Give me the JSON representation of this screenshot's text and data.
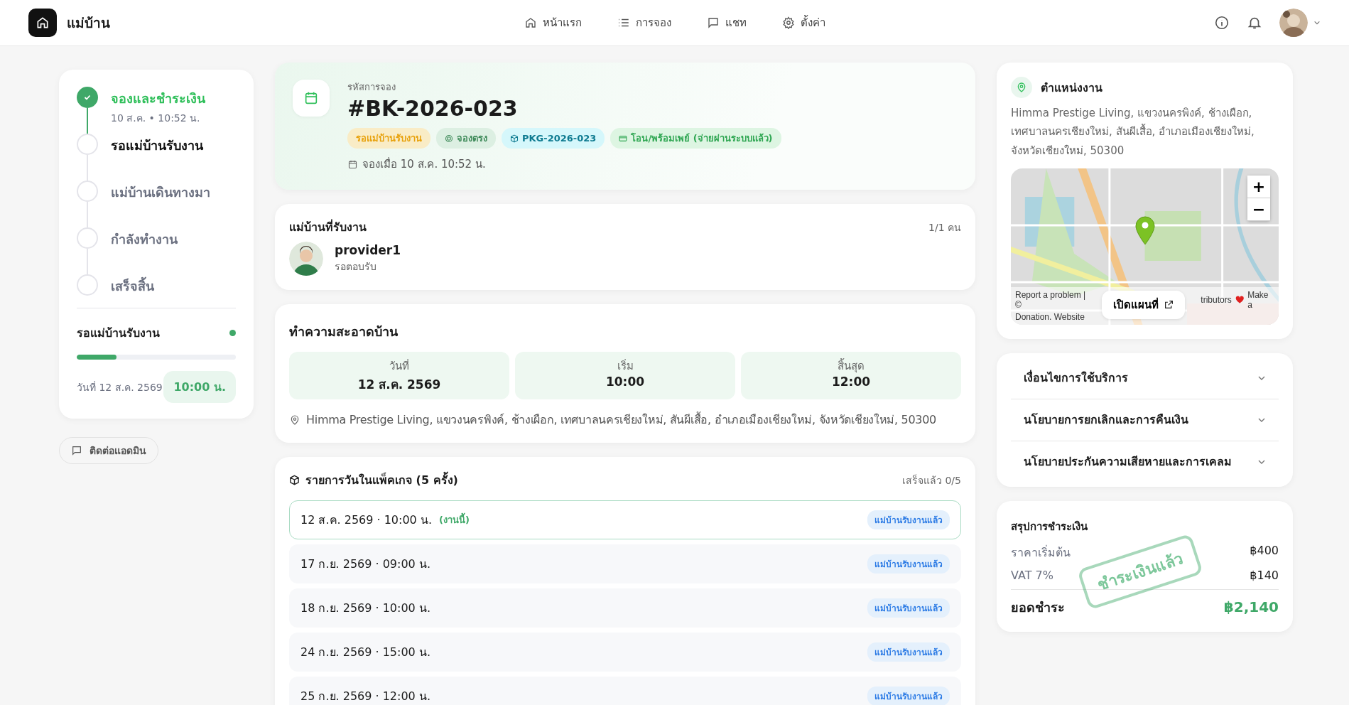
{
  "header": {
    "brand": "แม่บ้าน",
    "nav": [
      {
        "label": "หน้าแรก"
      },
      {
        "label": "การจอง"
      },
      {
        "label": "แชท"
      },
      {
        "label": "ตั้งค่า"
      }
    ]
  },
  "progress": {
    "steps": [
      {
        "label": "จองและชำระเงิน",
        "time": "10 ส.ค. • 10:52 น.",
        "kind": "done"
      },
      {
        "label": "รอแม่บ้านรับงาน",
        "kind": "current"
      },
      {
        "label": "แม่บ้านเดินทางมา",
        "kind": "pending"
      },
      {
        "label": "กำลังทำงาน",
        "kind": "pending"
      },
      {
        "label": "เสร็จสิ้น",
        "kind": "pending"
      }
    ],
    "status": "รอแม่บ้านรับงาน",
    "level": 0.25,
    "date": "วันที่ 12 ส.ค. 2569",
    "time": "10:00 น."
  },
  "contact_button": "ติดต่อแอดมิน",
  "booking": {
    "code_label": "รหัสการจอง",
    "code": "#BK-2026-023",
    "chips": [
      {
        "label": "รอแม่บ้านรับงาน",
        "kind": "status"
      },
      {
        "label": "จองตรง",
        "kind": "source"
      },
      {
        "label": "PKG-2026-023",
        "kind": "package"
      },
      {
        "label": "โอน/พร้อมเพย์ (จ่ายผ่านระบบแล้ว)",
        "kind": "payment"
      }
    ],
    "booked_at": "จองเมื่อ 10 ส.ค. 10:52 น."
  },
  "providers": {
    "title": "แม่บ้านที่รับงาน",
    "count": "1/1 คน",
    "items": [
      {
        "name": "provider1",
        "status": "รอตอบรับ"
      }
    ]
  },
  "service": {
    "title": "ทำความสะอาดบ้าน",
    "facts": [
      {
        "label": "วันที่",
        "value": "12 ส.ค. 2569"
      },
      {
        "label": "เริ่ม",
        "value": "10:00"
      },
      {
        "label": "สิ้นสุด",
        "value": "12:00"
      }
    ],
    "address": "Himma Prestige Living, แขวงนครพิงค์, ช้างเผือก, เทศบาลนครเชียงใหม่, สันผีเสื้อ, อำเภอเมืองเชียงใหม่, จังหวัดเชียงใหม่, 50300"
  },
  "package": {
    "title": "รายการวันในแพ็คเกจ (5 ครั้ง)",
    "progress": "เสร็จแล้ว 0/5",
    "rows": [
      {
        "when": "12 ส.ค. 2569 · 10:00 น.",
        "note": "(งานนี้)",
        "current": true,
        "status": "แม่บ้านรับงานแล้ว"
      },
      {
        "when": "17 ก.ย. 2569 · 09:00 น.",
        "current": false,
        "status": "แม่บ้านรับงานแล้ว"
      },
      {
        "when": "18 ก.ย. 2569 · 10:00 น.",
        "current": false,
        "status": "แม่บ้านรับงานแล้ว"
      },
      {
        "when": "24 ก.ย. 2569 · 15:00 น.",
        "current": false,
        "status": "แม่บ้านรับงานแล้ว"
      },
      {
        "when": "25 ก.ย. 2569 · 12:00 น.",
        "current": false,
        "status": "แม่บ้านรับงานแล้ว"
      }
    ]
  },
  "location": {
    "title": "ตำแหน่งงาน",
    "address": "Himma Prestige Living, แขวงนครพิงค์, ช้างเผือก, เทศบาลนครเชียงใหม่, สันผีเสื้อ, อำเภอเมืองเชียงใหม่, จังหวัดเชียงใหม่, 50300",
    "zoom_in": "+",
    "zoom_out": "−",
    "attribution": [
      "Report a problem | ©",
      "tributors",
      "Make a",
      "Donation. Website"
    ],
    "open_map": "เปิดแผนที่"
  },
  "policies": [
    {
      "label": "เงื่อนไขการใช้บริการ",
      "expanded": false
    },
    {
      "label": "นโยบายการยกเลิกและการคืนเงิน",
      "expanded": false
    },
    {
      "label": "นโยบายประกันความเสียหายและการเคลม",
      "expanded": false
    }
  ],
  "payment": {
    "title": "สรุปการชำระเงิน",
    "lines": [
      {
        "label": "ราคาเริ่มต้น",
        "value": "฿400"
      },
      {
        "label": "VAT 7%",
        "value": "฿140"
      }
    ],
    "total_label": "ยอดชำระ",
    "total": "฿2,140",
    "stamp": "ชำระเงินแล้ว"
  }
}
